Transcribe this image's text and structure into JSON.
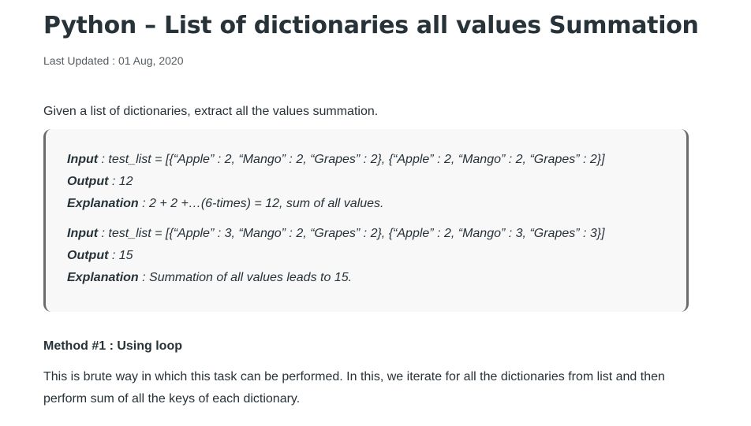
{
  "article": {
    "title": "Python – List of dictionaries all values Summation",
    "last_updated": "Last Updated : 01 Aug, 2020",
    "intro": "Given a list of dictionaries, extract all the values summation."
  },
  "examples": [
    {
      "input_label": "Input",
      "input_value": " : test_list = [{“Apple” : 2, “Mango” : 2, “Grapes” : 2}, {“Apple” : 2, “Mango” : 2, “Grapes” : 2}]",
      "output_label": "Output",
      "output_value": " : 12",
      "explanation_label": "Explanation",
      "explanation_value": " : 2 + 2 +…(6-times) = 12, sum of all values."
    },
    {
      "input_label": "Input",
      "input_value": " : test_list = [{“Apple” : 3, “Mango” : 2, “Grapes” : 2}, {“Apple” : 2, “Mango” : 3, “Grapes” : 3}]",
      "output_label": "Output",
      "output_value": " : 15",
      "explanation_label": "Explanation",
      "explanation_value": " : Summation of all values leads to 15."
    }
  ],
  "method": {
    "heading": "Method #1 : Using loop",
    "description": "This is brute way in which this task can be performed. In this, we iterate for all the dictionaries from list and then perform sum of all the keys of each dictionary."
  }
}
